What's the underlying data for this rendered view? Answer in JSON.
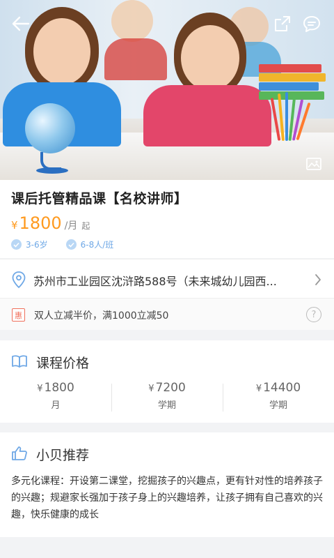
{
  "hero": {
    "back_icon": "arrow-left-icon",
    "share_icon": "share-icon",
    "message_icon": "chat-bubble-icon",
    "gallery_icon": "image-gallery-icon"
  },
  "course": {
    "title": "课后托管精品课【名校讲师】",
    "price_currency": "¥",
    "price_amount": "1800",
    "price_unit": "/月",
    "price_from": "起",
    "tags": [
      "3-6岁",
      "6-8人/班"
    ]
  },
  "address": {
    "text": "苏州市工业园区沈浒路588号（未来城幼儿园西...",
    "icon": "location-pin-icon"
  },
  "promo": {
    "badge": "惠",
    "text": "双人立减半价，满1000立减50",
    "help": "?"
  },
  "pricing": {
    "title": "课程价格",
    "items": [
      {
        "currency": "¥",
        "amount": "1800",
        "period": "月"
      },
      {
        "currency": "¥",
        "amount": "7200",
        "period": "学期"
      },
      {
        "currency": "¥",
        "amount": "14400",
        "period": "学期"
      }
    ]
  },
  "recommend": {
    "title": "小贝推荐",
    "body": "多元化课程：开设第二课堂，挖掘孩子的兴趣点，更有针对性的培养孩子的兴趣；规避家长强加于孩子身上的兴趣培养，让孩子拥有自己喜欢的兴趣，快乐健康的成长"
  },
  "colors": {
    "accent_orange": "#ff9a1f",
    "tag_blue": "#6fa8e6",
    "promo_red": "#f0705c"
  }
}
